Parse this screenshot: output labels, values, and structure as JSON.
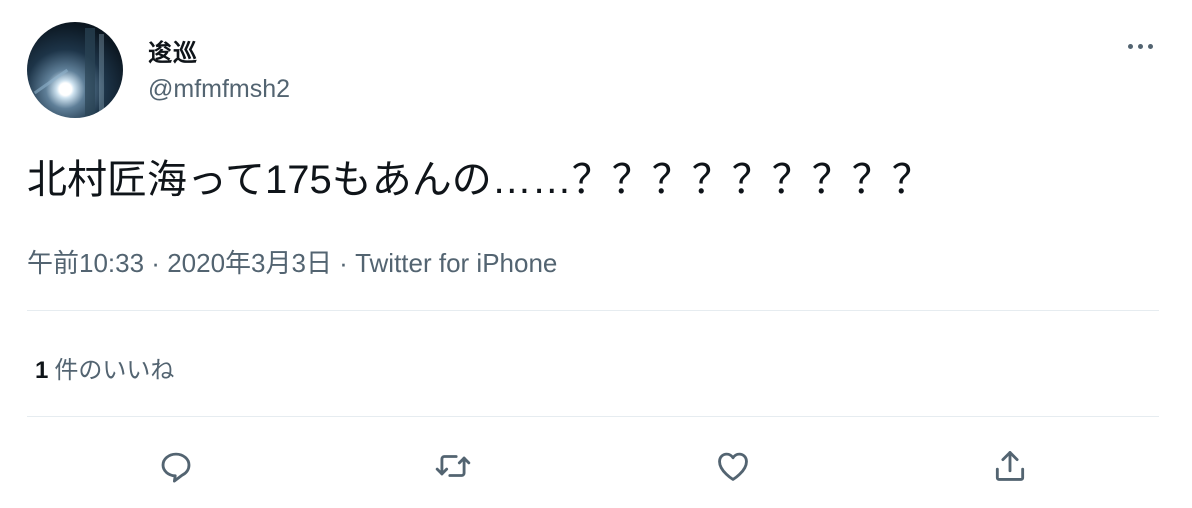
{
  "user": {
    "display_name": "逡巡",
    "handle": "@mfmfmsh2",
    "avatar_icon": "avatar-photo"
  },
  "more_icon": "more-horizontal-icon",
  "tweet": {
    "text": "北村匠海って175もあんの……？？？？？？？？？",
    "time": "午前10:33",
    "date": "2020年3月3日",
    "separator": " · ",
    "source": "Twitter for iPhone"
  },
  "stats": {
    "likes_count": "1",
    "likes_label": "件のいいね"
  },
  "actions": [
    {
      "name": "reply",
      "icon": "reply-icon"
    },
    {
      "name": "retweet",
      "icon": "retweet-icon"
    },
    {
      "name": "like",
      "icon": "heart-icon"
    },
    {
      "name": "share",
      "icon": "share-icon"
    }
  ],
  "colors": {
    "text": "#0f1419",
    "secondary": "#536471",
    "divider": "#e6ecf0"
  }
}
